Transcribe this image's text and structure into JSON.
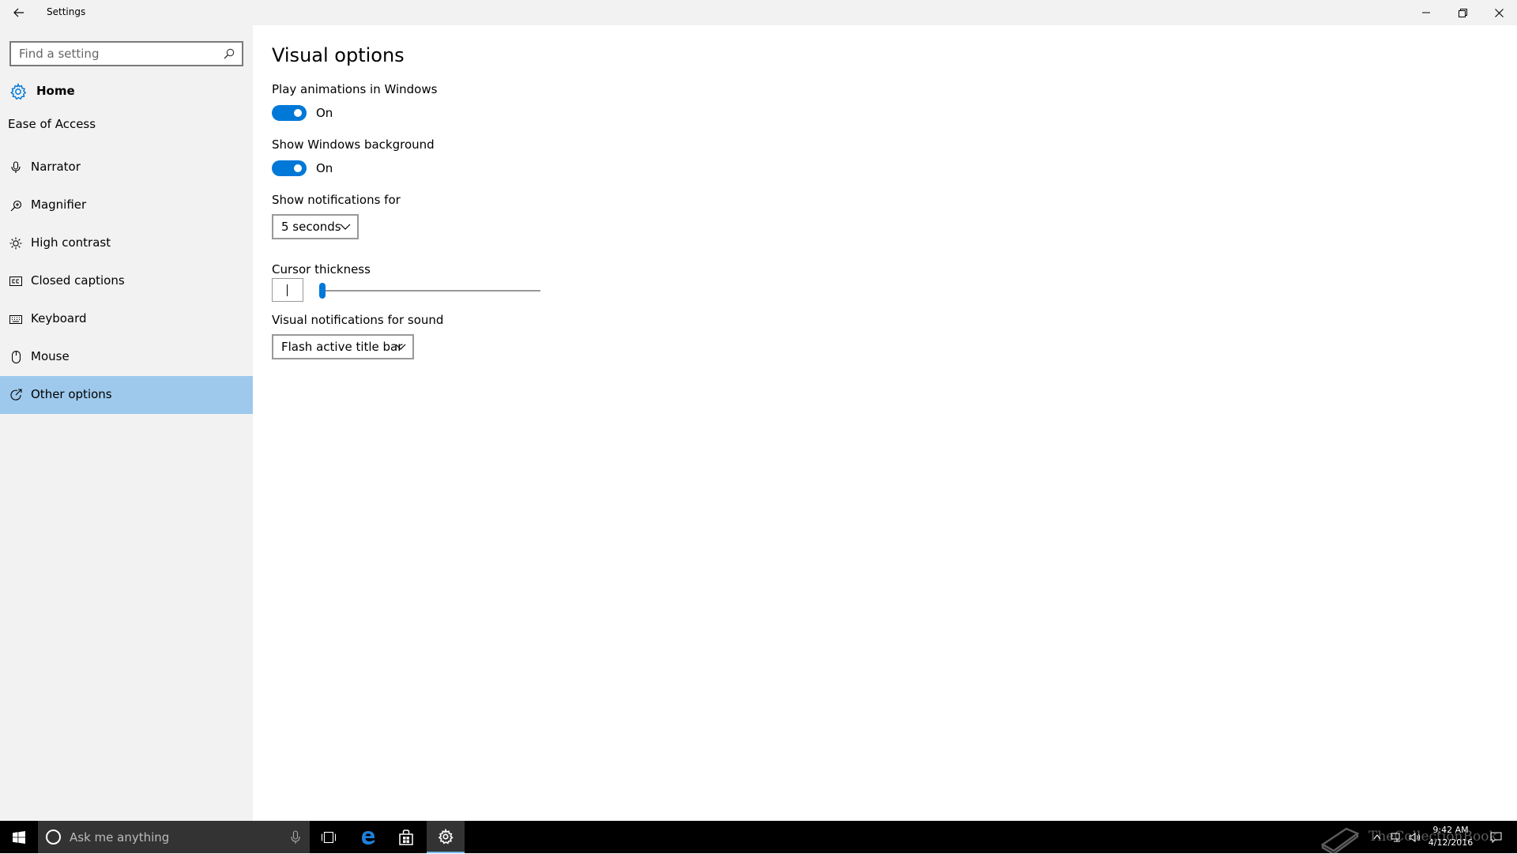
{
  "window": {
    "title": "Settings"
  },
  "sidebar": {
    "search_placeholder": "Find a setting",
    "home_label": "Home",
    "section_heading": "Ease of Access",
    "items": [
      {
        "label": "Narrator",
        "icon": "narrator-icon",
        "active": false
      },
      {
        "label": "Magnifier",
        "icon": "magnifier-icon",
        "active": false
      },
      {
        "label": "High contrast",
        "icon": "high-contrast-icon",
        "active": false
      },
      {
        "label": "Closed captions",
        "icon": "closed-captions-icon",
        "active": false
      },
      {
        "label": "Keyboard",
        "icon": "keyboard-icon",
        "active": false
      },
      {
        "label": "Mouse",
        "icon": "mouse-icon",
        "active": false
      },
      {
        "label": "Other options",
        "icon": "other-options-icon",
        "active": true
      }
    ]
  },
  "main": {
    "title": "Visual options",
    "animations": {
      "label": "Play animations in Windows",
      "state": "On",
      "on": true
    },
    "background": {
      "label": "Show Windows background",
      "state": "On",
      "on": true
    },
    "notifications": {
      "label": "Show notifications for",
      "value": "5 seconds"
    },
    "cursor": {
      "label": "Cursor thickness",
      "value": 1,
      "min": 1,
      "max": 20
    },
    "sound": {
      "label": "Visual notifications for sound",
      "value": "Flash active title bar"
    }
  },
  "taskbar": {
    "search_placeholder": "Ask me anything",
    "clock_time": "9:42 AM",
    "clock_date": "4/12/2016",
    "watermark": "TheCollectionBook"
  },
  "colors": {
    "accent": "#0078d7",
    "selected_nav": "#9ec9ed",
    "chrome": "#f2f2f2",
    "taskbar": "#000000"
  }
}
